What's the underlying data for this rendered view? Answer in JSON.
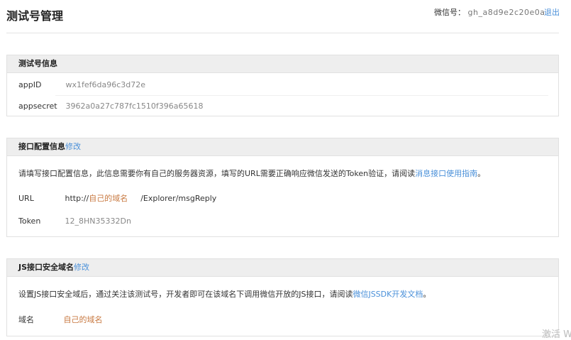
{
  "header": {
    "title": "测试号管理",
    "account_label": "微信号：",
    "account_value": "gh_a8d9e2c20e0a",
    "logout": "退出"
  },
  "test_info": {
    "title": "测试号信息",
    "appid_label": "appID",
    "appid_value": "wx1fef6da96c3d72e",
    "appsecret_label": "appsecret",
    "appsecret_value": "3962a0a27c787fc1510f396a65618"
  },
  "api_config": {
    "title": "接口配置信息",
    "edit": "修改",
    "desc": "请填写接口配置信息，此信息需要你有自己的服务器资源，填写的URL需要正确响应微信发送的Token验证，请阅读",
    "desc_link": "消息接口使用指南",
    "desc_end": "。",
    "url_label": "URL",
    "url_prefix": "http://",
    "url_domain": "自己的域名",
    "url_suffix": "/Explorer/msgReply",
    "token_label": "Token",
    "token_value": "12_8HN35332Dn"
  },
  "js_domain": {
    "title": "JS接口安全域名",
    "edit": "修改",
    "desc": "设置JS接口安全域后，通过关注该测试号，开发者即可在该域名下调用微信开放的JS接口，请阅读",
    "desc_link": "微信JSSDK开发文档",
    "desc_end": "。",
    "domain_label": "域名",
    "domain_value": "自己的域名"
  },
  "watermark": "激活 W"
}
